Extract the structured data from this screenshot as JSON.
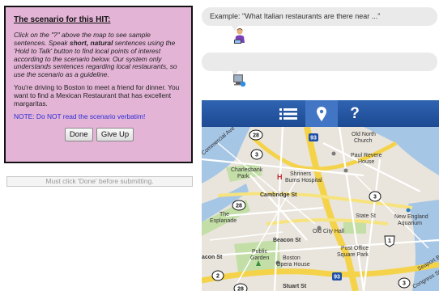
{
  "scenario": {
    "title": "The scenario for this HIT:",
    "instr_1": "Click on the \"?\" above the map to see sample sentences. Speak ",
    "instr_bold": "short, natural",
    "instr_2": " sentences using the 'Hold to Talk' button to find local points of interest according to the scenario below. Our system only understands sentences regarding local restaurants, so use the scenario as a guideline.",
    "body": "You're driving to Boston to meet a friend for dinner. You want to find a Mexican Restaurant that has excellent margaritas.",
    "note": "NOTE: Do NOT read the scenario verbatim!",
    "done_label": "Done",
    "giveup_label": "Give Up"
  },
  "submit_notice": "Must click 'Done' before submitting.",
  "chat": {
    "example_text": "Example: \"What Italian restaurants are there near ...\"",
    "response_text": ""
  },
  "toolbar": {
    "list_icon": "list-icon",
    "pin_icon": "map-pin-icon",
    "help_label": "?"
  },
  "map": {
    "labels": {
      "old_north_church": "Old North\nChurch",
      "paul_revere": "Paul Revere\nHouse",
      "charlesbank": "Charlesbank\nPark",
      "shriners": "Shriners\nBurns Hospital",
      "cambridge_st": "Cambridge St",
      "the_esplanade": "The\nEsplanade",
      "state_st": "State St",
      "new_england_aquarium": "New England\nAquarium",
      "old_city_hall": "Old City Hall",
      "beacon_st": "Beacon St",
      "post_office_sq": "Post Office\nSquare Park",
      "public_garden": "Public\nGarden",
      "boston_opera": "Boston\nOpera House",
      "stuart_st": "Stuart St",
      "seaport_blvd": "Seaport Blvd",
      "commercial_ave": "Commercial Ave",
      "congress_st": "Congress St",
      "beacon_st_2": "acon St"
    },
    "shields": [
      "28",
      "3",
      "93",
      "3",
      "28",
      "1",
      "2",
      "28",
      "93",
      "3"
    ]
  }
}
